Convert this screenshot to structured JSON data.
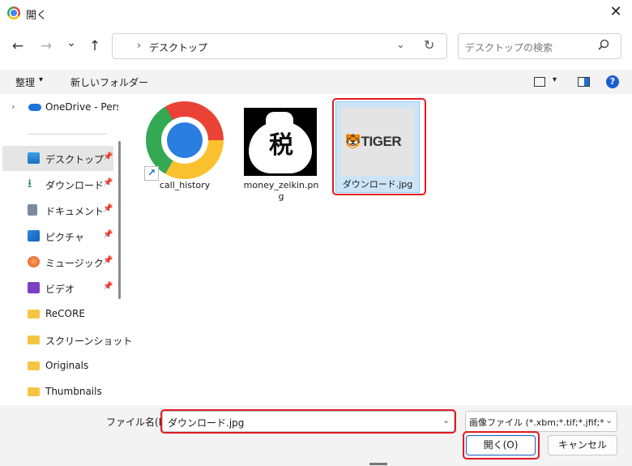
{
  "window": {
    "title": "開く",
    "app_icon": "chrome-icon",
    "close_glyph": "✕"
  },
  "nav": {
    "back_glyph": "←",
    "forward_glyph": "→",
    "recent_glyph": "⌄",
    "up_glyph": "↑",
    "address_separator": "›",
    "address": "デスクトップ",
    "address_dropdown_glyph": "⌄",
    "refresh_glyph": "↻",
    "search_placeholder": "デスクトップの検索"
  },
  "commandbar": {
    "organize_label": "整理",
    "organize_chevron": "▾",
    "new_folder_label": "新しいフォルダー",
    "view_chevron": "▾",
    "help_glyph": "?"
  },
  "sidebar": {
    "onedrive": {
      "chevron": "›",
      "label": "OneDrive - Perso"
    },
    "items": [
      {
        "label": "デスクトップ",
        "icon": "desktop-icon",
        "pinned": true,
        "selected": true
      },
      {
        "label": "ダウンロード",
        "icon": "download-icon",
        "pinned": true
      },
      {
        "label": "ドキュメント",
        "icon": "document-icon",
        "pinned": true
      },
      {
        "label": "ピクチャ",
        "icon": "pictures-icon",
        "pinned": true
      },
      {
        "label": "ミュージック",
        "icon": "music-icon",
        "pinned": true
      },
      {
        "label": "ビデオ",
        "icon": "video-icon",
        "pinned": true
      },
      {
        "label": "ReCORE",
        "icon": "folder-icon"
      },
      {
        "label": "スクリーンショット",
        "icon": "folder-icon"
      },
      {
        "label": "Originals",
        "icon": "folder-icon"
      },
      {
        "label": "Thumbnails",
        "icon": "folder-icon"
      }
    ],
    "pin_glyph": "📌"
  },
  "files": [
    {
      "name": "call_history",
      "type": "shortcut",
      "icon": "chrome-icon",
      "shortcut_glyph": "↗"
    },
    {
      "name": "money_zeikin.png",
      "type": "image",
      "thumb_char": "税"
    },
    {
      "name": "ダウンロード.jpg",
      "type": "image",
      "thumb_text": "🐯TIGER",
      "selected": true
    }
  ],
  "footer": {
    "filename_label": "ファイル名(N):",
    "filename_value": "ダウンロード.jpg",
    "dropdown_glyph": "⌄",
    "filetype_value": "画像ファイル (*.xbm;*.tif;*.jfif;*.ico;",
    "open_label": "開く(O)",
    "cancel_label": "キャンセル"
  },
  "colors": {
    "accent": "#1a5fd1",
    "highlight": "#e01b24",
    "selection": "#cce4f7"
  }
}
